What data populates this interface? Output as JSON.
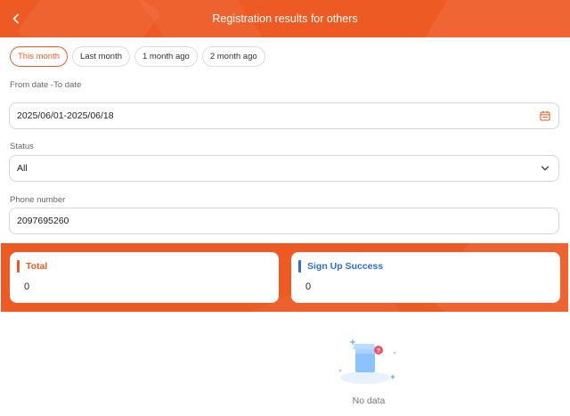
{
  "header": {
    "title": "Registration results for others"
  },
  "tabs": [
    {
      "label": "This month",
      "active": true
    },
    {
      "label": "Last month",
      "active": false
    },
    {
      "label": "1 month ago",
      "active": false
    },
    {
      "label": "2 month ago",
      "active": false
    }
  ],
  "date_range": {
    "label": "From date -To date",
    "value": "2025/06/01-2025/06/18"
  },
  "status": {
    "label": "Status",
    "value": "All"
  },
  "phone": {
    "label": "Phone number",
    "value": "2097695260"
  },
  "stats": {
    "total": {
      "title": "Total",
      "value": "0",
      "accent": "#ee5a24"
    },
    "success": {
      "title": "Sign Up Success",
      "value": "0",
      "accent": "#2f6fd1"
    }
  },
  "empty": {
    "text": "No data"
  },
  "colors": {
    "brand": "#ee5a24",
    "blue_accent": "#2f6fd1"
  },
  "icons": {
    "back": "chevron-left-icon",
    "calendar": "calendar-icon",
    "dropdown": "chevron-down-icon",
    "empty": "empty-box-icon"
  }
}
